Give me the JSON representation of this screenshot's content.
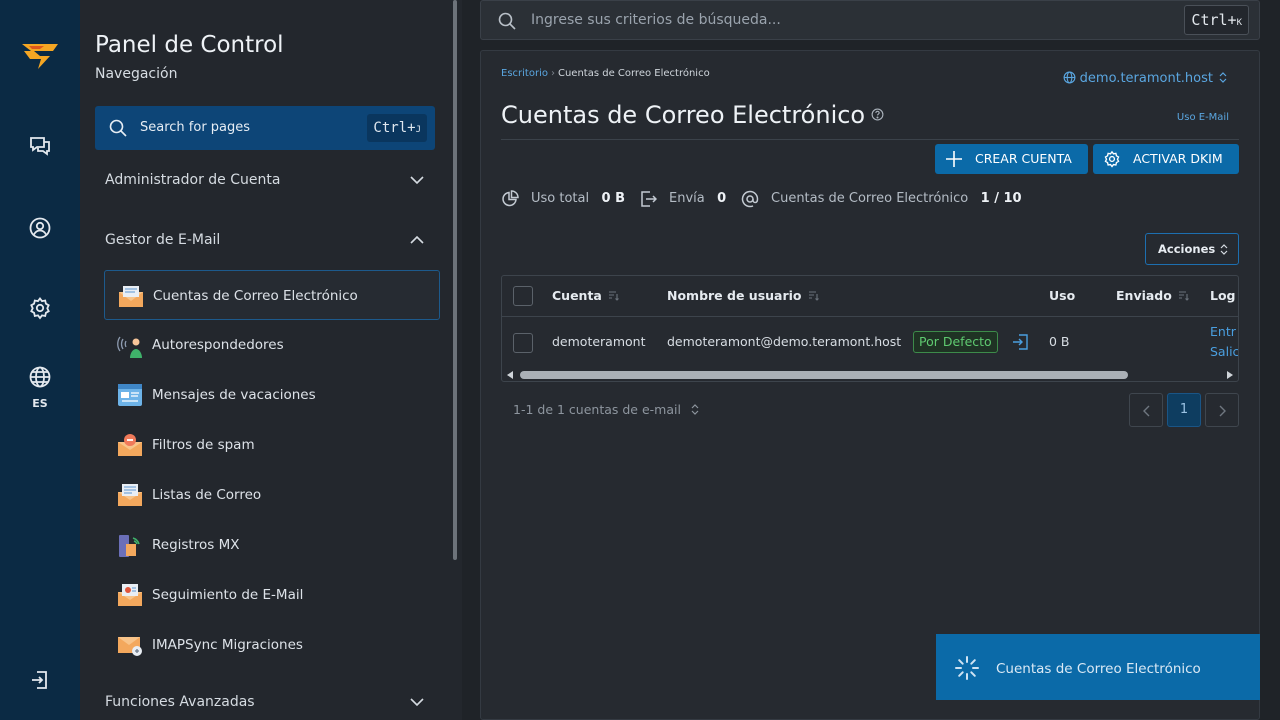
{
  "rail": {
    "lang": "ES",
    "icons": [
      "brand-logo",
      "chat-icon",
      "user-circle-icon",
      "gear-icon",
      "globe-icon",
      "logout-icon"
    ],
    "accent": "#f5a623"
  },
  "nav": {
    "title": "Panel de Control",
    "subtitle": "Navegación",
    "search_label": "Search for pages",
    "search_kbd": "Ctrl+",
    "search_kbd_key": "J",
    "sections": {
      "admin": "Administrador de Cuenta",
      "email": "Gestor de E-Mail",
      "advanced": "Funciones Avanzadas"
    },
    "items": [
      {
        "label": "Cuentas de Correo Electrónico",
        "icon": "envelope-inbox-icon"
      },
      {
        "label": "Autorespondedores",
        "icon": "autoresponder-icon"
      },
      {
        "label": "Mensajes de vacaciones",
        "icon": "vacation-message-icon"
      },
      {
        "label": "Filtros de spam",
        "icon": "spam-filter-icon"
      },
      {
        "label": "Listas de Correo",
        "icon": "mailing-list-icon"
      },
      {
        "label": "Registros MX",
        "icon": "mx-records-icon"
      },
      {
        "label": "Seguimiento de E-Mail",
        "icon": "email-tracking-icon"
      },
      {
        "label": "IMAPSync Migraciones",
        "icon": "imapsync-icon"
      }
    ]
  },
  "topbar": {
    "search_placeholder": "Ingrese sus criterios de búsqueda...",
    "kbd": "Ctrl+",
    "kbd_key": "K"
  },
  "page": {
    "breadcrumb": {
      "home": "Escritorio",
      "current": "Cuentas de Correo Electrónico"
    },
    "domain": "demo.teramont.host",
    "title": "Cuentas de Correo Electrónico",
    "usage_link": "Uso E-Mail",
    "buttons": {
      "create": "CREAR CUENTA",
      "dkim": "ACTIVAR DKIM"
    },
    "stats": {
      "usage_label": "Uso total",
      "usage_value": "0 B",
      "sent_label": "Envía",
      "sent_value": "0",
      "accounts_label": "Cuentas de Correo Electrónico",
      "accounts_value": "1 / 10"
    },
    "actions_label": "Acciones",
    "table": {
      "columns": [
        "Cuenta",
        "Nombre de usuario",
        "Uso",
        "Enviado",
        "Log"
      ],
      "rows": [
        {
          "account": "demoteramont",
          "username": "demoteramont@demo.teramont.host",
          "badge": "Por Defecto",
          "usage": "0 B",
          "log_in": "Entr",
          "log_out": "Salic"
        }
      ]
    },
    "pagination": {
      "info": "1-1 de 1 cuentas de e-mail",
      "current": "1"
    },
    "toast": "Cuentas de Correo Electrónico"
  }
}
